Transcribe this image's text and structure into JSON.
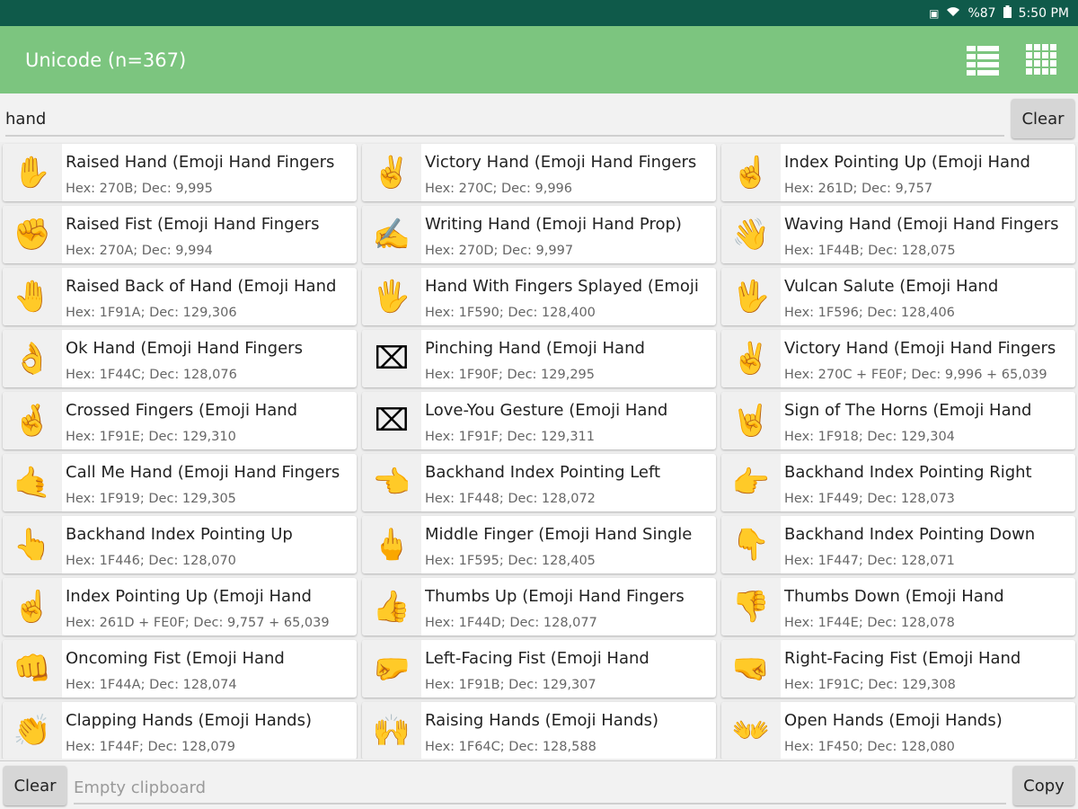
{
  "status_bar": {
    "battery_percent": "%87",
    "time": "5:50 PM",
    "icons": [
      "notification-icon",
      "wifi-icon",
      "battery-icon"
    ]
  },
  "app_bar": {
    "title": "Unicode (n=367)",
    "actions": [
      "list-view-icon",
      "grid-view-icon"
    ]
  },
  "search": {
    "value": "hand",
    "clear_label": "Clear"
  },
  "items": [
    {
      "glyph": "✋",
      "name": "Raised Hand (Emoji Hand Fingers",
      "codes": "Hex: 270B; Dec: 9,995"
    },
    {
      "glyph": "✌️",
      "name": "Victory Hand (Emoji Hand Fingers",
      "codes": "Hex: 270C; Dec: 9,996"
    },
    {
      "glyph": "☝️",
      "name": "Index Pointing Up (Emoji Hand",
      "codes": "Hex: 261D; Dec: 9,757"
    },
    {
      "glyph": "✊",
      "name": "Raised Fist (Emoji Hand Fingers",
      "codes": "Hex: 270A; Dec: 9,994"
    },
    {
      "glyph": "✍️",
      "name": "Writing Hand (Emoji Hand Prop)",
      "codes": "Hex: 270D; Dec: 9,997"
    },
    {
      "glyph": "👋",
      "name": "Waving Hand (Emoji Hand Fingers",
      "codes": "Hex: 1F44B; Dec: 128,075"
    },
    {
      "glyph": "🤚",
      "name": "Raised Back of Hand (Emoji Hand",
      "codes": "Hex: 1F91A; Dec: 129,306"
    },
    {
      "glyph": "🖐️",
      "name": "Hand With Fingers Splayed (Emoji",
      "codes": "Hex: 1F590; Dec: 128,400"
    },
    {
      "glyph": "🖖",
      "name": "Vulcan Salute (Emoji Hand",
      "codes": "Hex: 1F596; Dec: 128,406"
    },
    {
      "glyph": "👌",
      "name": "Ok Hand (Emoji Hand Fingers",
      "codes": "Hex: 1F44C; Dec: 128,076"
    },
    {
      "glyph": "⌧",
      "name": "Pinching Hand (Emoji Hand",
      "codes": "Hex: 1F90F; Dec: 129,295"
    },
    {
      "glyph": "✌️",
      "name": "Victory Hand (Emoji Hand Fingers",
      "codes": "Hex: 270C + FE0F; Dec: 9,996 + 65,039"
    },
    {
      "glyph": "🤞",
      "name": "Crossed Fingers (Emoji Hand",
      "codes": "Hex: 1F91E; Dec: 129,310"
    },
    {
      "glyph": "⌧",
      "name": "Love-You Gesture (Emoji Hand",
      "codes": "Hex: 1F91F; Dec: 129,311"
    },
    {
      "glyph": "🤘",
      "name": "Sign of The Horns (Emoji Hand",
      "codes": "Hex: 1F918; Dec: 129,304"
    },
    {
      "glyph": "🤙",
      "name": "Call Me Hand (Emoji Hand Fingers",
      "codes": "Hex: 1F919; Dec: 129,305"
    },
    {
      "glyph": "👈",
      "name": "Backhand Index Pointing Left",
      "codes": "Hex: 1F448; Dec: 128,072"
    },
    {
      "glyph": "👉",
      "name": "Backhand Index Pointing Right",
      "codes": "Hex: 1F449; Dec: 128,073"
    },
    {
      "glyph": "👆",
      "name": "Backhand Index Pointing Up",
      "codes": "Hex: 1F446; Dec: 128,070"
    },
    {
      "glyph": "🖕",
      "name": "Middle Finger (Emoji Hand Single",
      "codes": "Hex: 1F595; Dec: 128,405"
    },
    {
      "glyph": "👇",
      "name": "Backhand Index Pointing Down",
      "codes": "Hex: 1F447; Dec: 128,071"
    },
    {
      "glyph": "☝️",
      "name": "Index Pointing Up (Emoji Hand",
      "codes": "Hex: 261D + FE0F; Dec: 9,757 + 65,039"
    },
    {
      "glyph": "👍",
      "name": "Thumbs Up (Emoji Hand Fingers",
      "codes": "Hex: 1F44D; Dec: 128,077"
    },
    {
      "glyph": "👎",
      "name": "Thumbs Down (Emoji Hand",
      "codes": "Hex: 1F44E; Dec: 128,078"
    },
    {
      "glyph": "👊",
      "name": "Oncoming Fist (Emoji Hand",
      "codes": "Hex: 1F44A; Dec: 128,074"
    },
    {
      "glyph": "🤛",
      "name": "Left-Facing Fist (Emoji Hand",
      "codes": "Hex: 1F91B; Dec: 129,307"
    },
    {
      "glyph": "🤜",
      "name": "Right-Facing Fist (Emoji Hand",
      "codes": "Hex: 1F91C; Dec: 129,308"
    },
    {
      "glyph": "👏",
      "name": "Clapping Hands (Emoji Hands)",
      "codes": "Hex: 1F44F; Dec: 128,079"
    },
    {
      "glyph": "🙌",
      "name": "Raising Hands (Emoji Hands)",
      "codes": "Hex: 1F64C; Dec: 128,588"
    },
    {
      "glyph": "👐",
      "name": "Open Hands (Emoji Hands)",
      "codes": "Hex: 1F450; Dec: 128,080"
    }
  ],
  "clipboard": {
    "clear_label": "Clear",
    "placeholder": "Empty clipboard",
    "copy_label": "Copy"
  },
  "colors": {
    "status_bar": "#0f5a4a",
    "app_bar": "#7cc57f",
    "card": "#ffffff",
    "button": "#d6d6d6"
  }
}
